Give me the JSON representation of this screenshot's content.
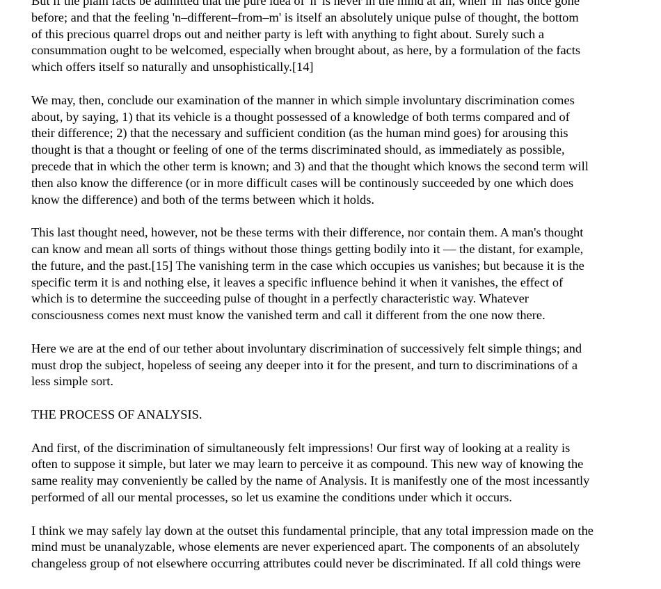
{
  "paragraphs": [
    {
      "lines": [
        "But if the plain facts be admitted that the pure idea of 'n' is never in the mind at all, when 'm' has once gone",
        "before; and that the feeling 'n–different–from–m' is itself an absolutely unique pulse of thought, the bottom",
        "of this precious quarrel drops out and neither party is left with anything to fight about. Surely such a",
        "consummation ought to be welcomed, especially when brought about, as here, by a formulation of the facts",
        "which offers itself so naturally and unsophistically.[14]"
      ]
    },
    {
      "lines": [
        "We may, then, conclude our examination of the manner in which simple involuntary discrimination comes",
        "about, by saying, 1) that its vehicle is a thought possessed of a knowledge of both terms compared and of",
        "their difference; 2) that the necessary and sufficient condition (as the human mind goes) for arousing this",
        "thought is that a thought or feeling of one of the terms discriminated should, as immediately as possible,",
        "precede that in which the other term is known; and 3) and that the thought which knows the second term will",
        "then also know the difference (or in more difficult cases will be continously succeeded by one which does",
        "know the difference) and both of the terms between which it holds."
      ]
    },
    {
      "lines": [
        "This last thought need, however, not be these terms with their difference, nor contain them. A man's thought",
        "can know and mean all sorts of things without those things getting bodily into it –– the distant, for example,",
        "the future, and the past.[15] The vanishing term in the case which occupies us vanishes; but because it is the",
        "specific term it is and nothing else, it leaves a specific influence behind it when it vanishes, the effect of",
        "which is to determine the succeeding pulse of thought in a perfectly characteristic way. Whatever",
        "consciousness comes next must know the vanished term and call it different from the one now there."
      ]
    },
    {
      "lines": [
        "Here we are at the end of our tether about involuntary discrimination of successively felt simple things; and",
        "must drop the subject, hopeless of seeing any deeper into it for the present, and turn to discriminations of a",
        "less simple sort."
      ]
    },
    {
      "lines": [
        "THE PROCESS OF ANALYSIS."
      ]
    },
    {
      "lines": [
        "And first, of the discrimination of simultaneously felt impressions! Our first way of looking at a reality is",
        "often to suppose it simple, but later we may learn to perceive it as compound. This new way of knowing the",
        "same reality may conveniently be called by the name of Analysis. It is manifestly one of the most incessantly",
        "performed of all our mental processes, so let us examine the conditions under which it occurs."
      ]
    },
    {
      "lines": [
        "I think we may safely lay down at the outset this fundamental principle, that any total impression made on the",
        "mind must be unanalyzable, whose elements are never experienced apart. The components of an absolutely",
        "changeless group of not elsewhere occurring attributes could never be discriminated. If all cold things were"
      ]
    }
  ]
}
